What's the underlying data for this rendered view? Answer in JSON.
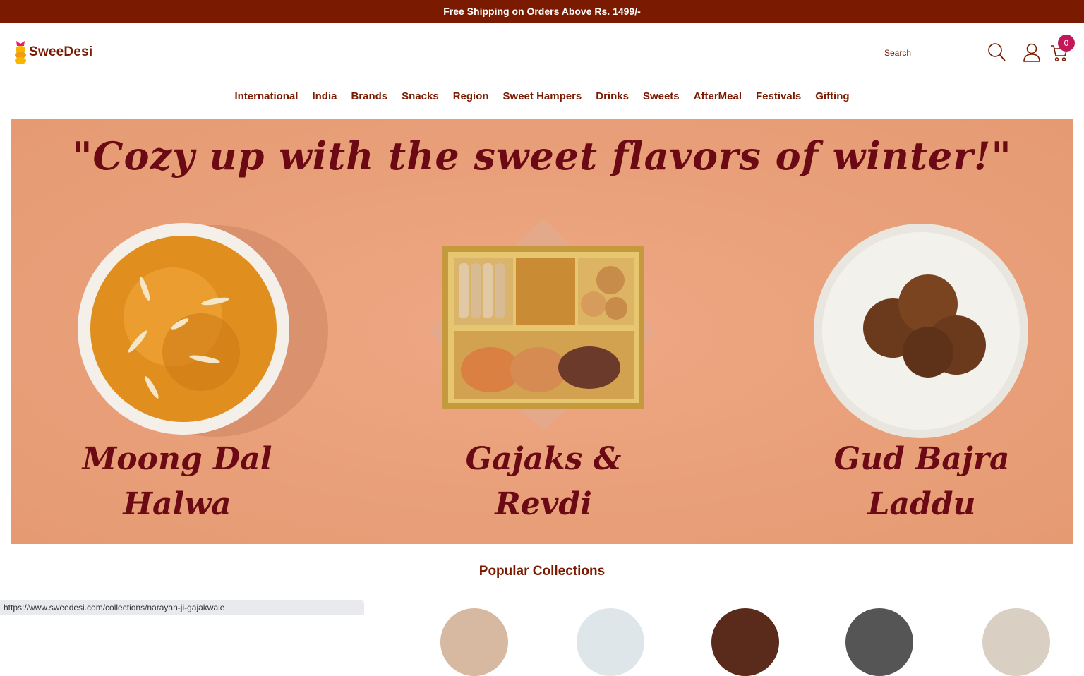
{
  "announcement": "Free Shipping on Orders Above Rs. 1499/-",
  "brand": {
    "name": "SweeDesi"
  },
  "header": {
    "search_placeholder": "Search",
    "cart_count": "0"
  },
  "nav": {
    "items": [
      {
        "label": "International"
      },
      {
        "label": "India"
      },
      {
        "label": "Brands"
      },
      {
        "label": "Snacks"
      },
      {
        "label": "Region"
      },
      {
        "label": "Sweet Hampers"
      },
      {
        "label": "Drinks"
      },
      {
        "label": "Sweets"
      },
      {
        "label": "AfterMeal"
      },
      {
        "label": "Festivals"
      },
      {
        "label": "Gifting"
      }
    ]
  },
  "banner": {
    "headline": "\"Cozy up with the sweet flavors of winter!\"",
    "products": [
      {
        "line1": "Moong Dal",
        "line2": "Halwa"
      },
      {
        "line1": "Gajaks &",
        "line2": "Revdi"
      },
      {
        "line1": "Gud Bajra",
        "line2": "Laddu"
      }
    ]
  },
  "collections": {
    "title": "Popular Collections"
  },
  "status_bar": {
    "url": "https://www.sweedesi.com/collections/narayan-ji-gajakwale"
  },
  "colors": {
    "brand": "#7a1a00",
    "banner_bg": "#e9a07a",
    "headline": "#6b0a14",
    "badge": "#c2185b"
  }
}
